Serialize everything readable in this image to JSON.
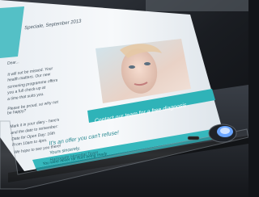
{
  "photo": {
    "subject": "scanner with a printed brochure on the glass",
    "brochure": {
      "lines": [
        "Speciale, September 2013",
        "Dear...",
        "It will not be missed. Your",
        "health matters. Our new",
        "screening programme offers",
        "you a full check-up at",
        "a time that suits you.",
        "Please be proud, so why not",
        "be happy?",
        "Mark it in your diary - here's",
        "and the date to remember:",
        "Date for Open Day: 16th",
        "From 10am to 4pm.",
        "We hope to see you there!",
        "It's an offer you can't refuse!",
        "Yours sincerely,",
        "Harrogate Hospital Team"
      ],
      "cta_text": "Contact our team for a free diagnosis",
      "footer_text": "You were never far from being ready"
    },
    "colors": {
      "background": "#141619",
      "paper": "#f2f6fa",
      "accent_teal": "#2fb3b8",
      "scanner_body": "#2a2e35"
    }
  }
}
